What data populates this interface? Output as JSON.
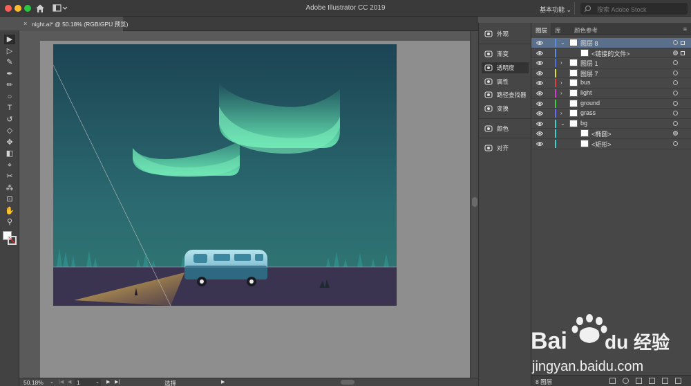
{
  "window": {
    "title": "Adobe Illustrator CC 2019",
    "workspace": "基本功能",
    "stock_search_placeholder": "搜索 Adobe Stock"
  },
  "document_tab": {
    "close": "×",
    "label": "night.ai* @ 50.18% (RGB/GPU 预览)"
  },
  "tools": [
    {
      "name": "selection-tool",
      "glyph": "▶"
    },
    {
      "name": "direct-selection-tool",
      "glyph": "▷"
    },
    {
      "name": "magic-wand-tool",
      "glyph": "✎"
    },
    {
      "name": "pen-tool",
      "glyph": "✒"
    },
    {
      "name": "curvature-tool",
      "glyph": "✏"
    },
    {
      "name": "ellipse-tool",
      "glyph": "○"
    },
    {
      "name": "type-tool",
      "glyph": "T"
    },
    {
      "name": "rotate-tool",
      "glyph": "↺"
    },
    {
      "name": "eraser-tool",
      "glyph": "◇"
    },
    {
      "name": "puppet-warp-tool",
      "glyph": "✥"
    },
    {
      "name": "gradient-tool",
      "glyph": "◧"
    },
    {
      "name": "eyedropper-tool",
      "glyph": "⌖"
    },
    {
      "name": "blend-tool",
      "glyph": "✂"
    },
    {
      "name": "symbol-sprayer-tool",
      "glyph": "⁂"
    },
    {
      "name": "artboard-tool",
      "glyph": "⊡"
    },
    {
      "name": "hand-tool",
      "glyph": "✋"
    },
    {
      "name": "zoom-tool",
      "glyph": "⚲"
    }
  ],
  "mid_panel": [
    {
      "label": "外观",
      "icon": "appearance-icon"
    },
    {
      "label": "渐变",
      "icon": "gradient-icon"
    },
    {
      "label": "透明度",
      "icon": "transparency-icon",
      "active": true
    },
    {
      "label": "属性",
      "icon": "properties-icon"
    },
    {
      "label": "路径查找器",
      "icon": "pathfinder-icon"
    },
    {
      "label": "变换",
      "icon": "transform-icon"
    },
    {
      "label": "颜色",
      "icon": "color-icon"
    },
    {
      "label": "对齐",
      "icon": "align-icon"
    }
  ],
  "layers_panel": {
    "tabs": [
      "图层",
      "库",
      "颜色参考"
    ],
    "menu": "≡",
    "rows": [
      {
        "name": "图层 8",
        "color": "#5b8ce8",
        "twisty": "⌄",
        "indent": 0,
        "selected": true,
        "target_filled": false,
        "sel": true
      },
      {
        "name": "<链接的文件>",
        "color": "#5b8ce8",
        "twisty": "",
        "indent": 1,
        "selected": false,
        "target_filled": true,
        "sel": true
      },
      {
        "name": "图层 1",
        "color": "#4f6fe8",
        "twisty": "›",
        "indent": 0,
        "selected": false,
        "target_filled": false,
        "sel": false
      },
      {
        "name": "图层 7",
        "color": "#e0e040",
        "twisty": "",
        "indent": 0,
        "selected": false,
        "target_filled": false,
        "sel": false
      },
      {
        "name": "bus",
        "color": "#e04040",
        "twisty": "›",
        "indent": 0,
        "selected": false,
        "target_filled": false,
        "sel": false
      },
      {
        "name": "light",
        "color": "#d040d0",
        "twisty": "›",
        "indent": 0,
        "selected": false,
        "target_filled": false,
        "sel": false
      },
      {
        "name": "ground",
        "color": "#40d040",
        "twisty": "",
        "indent": 0,
        "selected": false,
        "target_filled": false,
        "sel": false
      },
      {
        "name": "grass",
        "color": "#6a6aff",
        "twisty": "›",
        "indent": 0,
        "selected": false,
        "target_filled": false,
        "sel": false
      },
      {
        "name": "bg",
        "color": "#40d0d0",
        "twisty": "⌄",
        "indent": 0,
        "selected": false,
        "target_filled": false,
        "sel": false
      },
      {
        "name": "<椭圆>",
        "color": "#40d0d0",
        "twisty": "",
        "indent": 1,
        "selected": false,
        "target_filled": true,
        "sel": false
      },
      {
        "name": "<矩形>",
        "color": "#40d0d0",
        "twisty": "",
        "indent": 1,
        "selected": false,
        "target_filled": false,
        "sel": false
      }
    ],
    "footer_count": "8 图层"
  },
  "status": {
    "zoom": "50.18%",
    "zoom_caret": "⌄",
    "page": "1",
    "page_caret": "⌄",
    "nav_first": "|◀",
    "nav_prev": "◀",
    "nav_next": "▶",
    "nav_last": "▶|",
    "tool": "选择",
    "arrow": "▶"
  },
  "watermark": {
    "brand": "Bai",
    "brand_suffix": "du",
    "cn": "经验",
    "url": "jingyan.baidu.com"
  },
  "colors": {
    "sky_top": "#1f4a5a",
    "sky_bottom": "#2a6e73",
    "aurora": "#5fe8b0",
    "ground": "#3d3350",
    "bus_top": "#9fd6e3",
    "bus_bottom": "#2f6f86",
    "headlight": "#f0c850"
  }
}
